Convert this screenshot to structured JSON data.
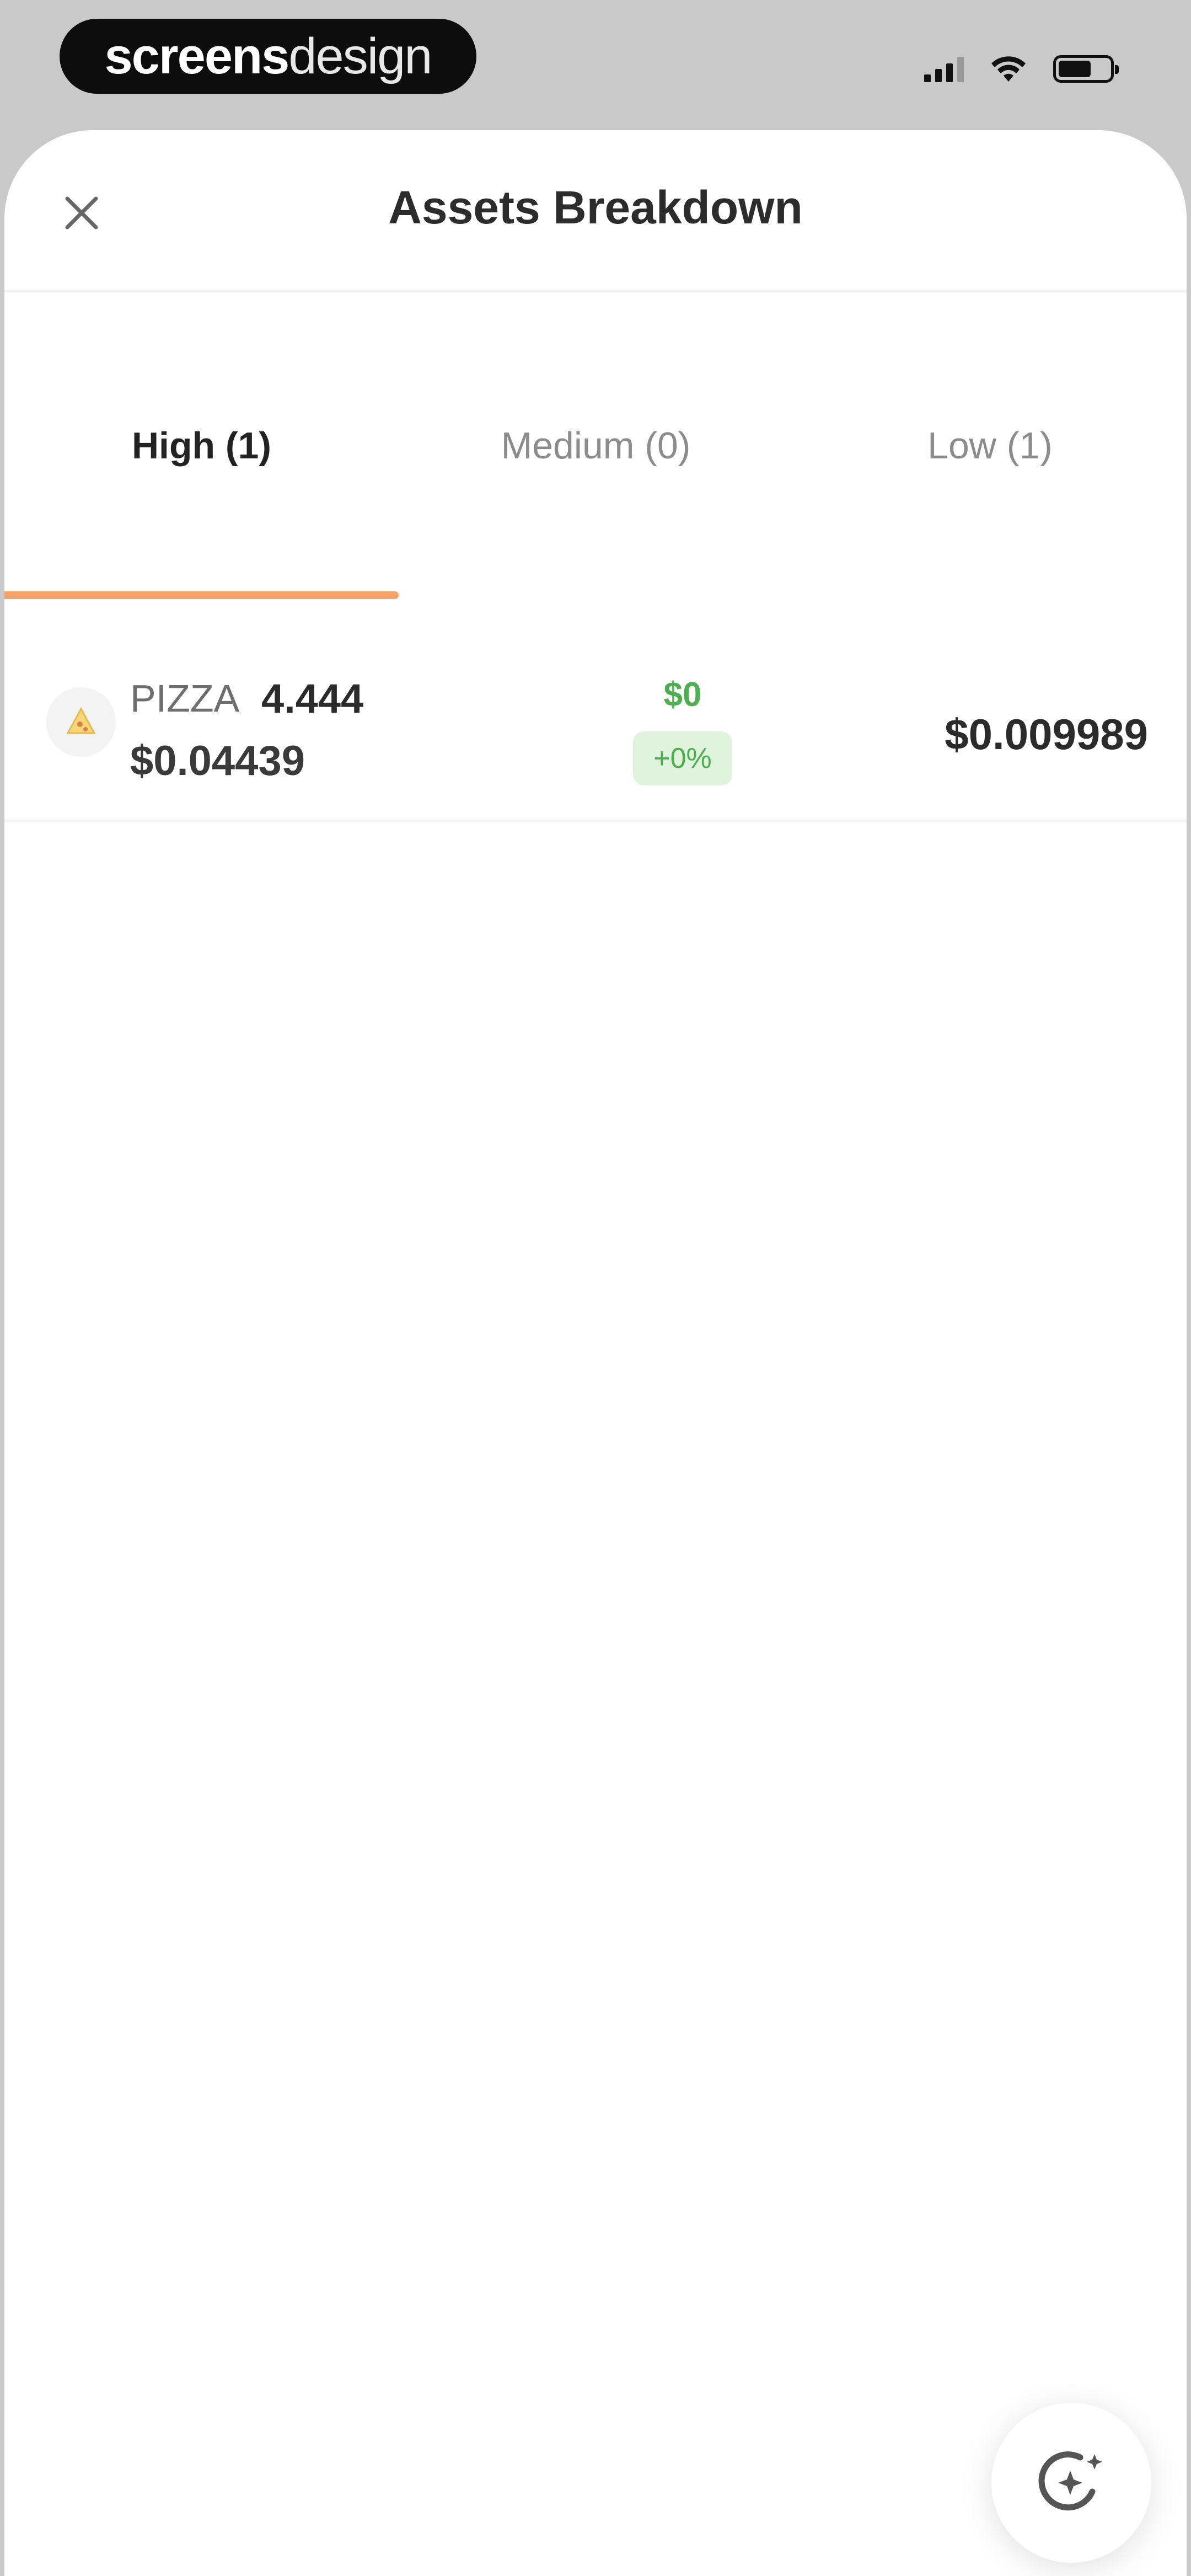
{
  "status_bar": {
    "brand_bold": "screens",
    "brand_light": "design"
  },
  "header": {
    "title": "Assets Breakdown",
    "close_icon": "close-icon"
  },
  "tabs": [
    {
      "label": "High (1)",
      "active": true
    },
    {
      "label": "Medium (0)",
      "active": false
    },
    {
      "label": "Low (1)",
      "active": false
    }
  ],
  "assets": [
    {
      "symbol": "PIZZA",
      "quantity": "4.444",
      "price": "$0.04439",
      "change_amount": "$0",
      "change_percent": "+0%",
      "value": "$0.009989",
      "icon": "pizza-token-icon"
    }
  ],
  "fab": {
    "icon": "ai-sparkle-icon"
  },
  "colors": {
    "accent": "#f4a36b",
    "positive": "#4caf50",
    "positive_bg": "#dff3dd"
  }
}
